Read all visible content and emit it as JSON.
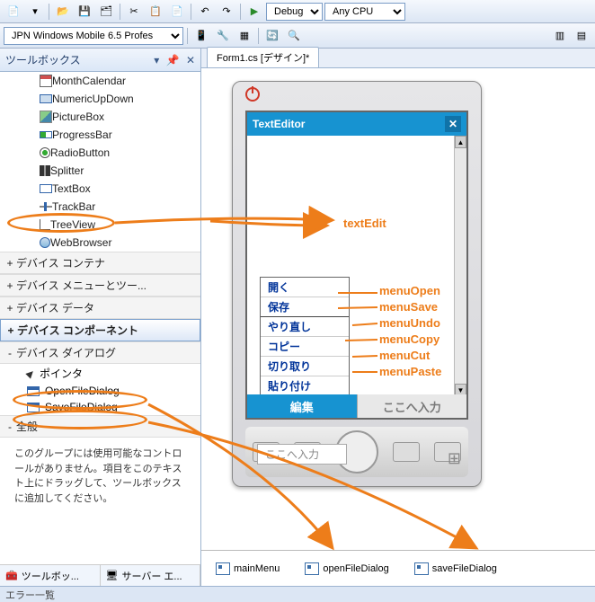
{
  "toolbar1": {
    "debug_config": "Debug",
    "platform": "Any CPU"
  },
  "toolbar2": {
    "device": "JPN Windows Mobile 6.5 Profes"
  },
  "toolbox": {
    "title": "ツールボックス",
    "items": [
      {
        "label": "MonthCalendar",
        "icon": "ico-cal"
      },
      {
        "label": "NumericUpDown",
        "icon": "ico-num"
      },
      {
        "label": "PictureBox",
        "icon": "ico-pic"
      },
      {
        "label": "ProgressBar",
        "icon": "ico-prog"
      },
      {
        "label": "RadioButton",
        "icon": "ico-radio"
      },
      {
        "label": "Splitter",
        "icon": "ico-split"
      },
      {
        "label": "TextBox",
        "icon": "ico-text"
      },
      {
        "label": "TrackBar",
        "icon": "ico-track"
      },
      {
        "label": "TreeView",
        "icon": "ico-tree"
      },
      {
        "label": "WebBrowser",
        "icon": "ico-web"
      }
    ],
    "cats": [
      {
        "label": "デバイス コンテナ",
        "exp": "+"
      },
      {
        "label": "デバイス メニューとツー...",
        "exp": "+"
      },
      {
        "label": "デバイス データ",
        "exp": "+"
      },
      {
        "label": "デバイス コンポーネント",
        "exp": "+",
        "sel": true
      },
      {
        "label": "デバイス ダイアログ",
        "exp": "-"
      }
    ],
    "dialog_items": [
      {
        "label": "ポインタ",
        "icon": "ico-ptr"
      },
      {
        "label": "OpenFileDialog",
        "icon": "ico-dlg"
      },
      {
        "label": "SaveFileDialog",
        "icon": "ico-dlg"
      }
    ],
    "general": {
      "label": "全般",
      "exp": "-"
    },
    "empty": "このグループには使用可能なコントロールがありません。項目をこのテキスト上にドラッグして、ツールボックスに追加してください。",
    "footer": {
      "tab1": "ツールボッ...",
      "tab2": "サーバー エ..."
    }
  },
  "designer": {
    "tab": "Form1.cs [デザイン]*",
    "form_title": "TextEditor",
    "menu": [
      "開く",
      "保存",
      "やり直し",
      "コピー",
      "切り取り",
      "貼り付け"
    ],
    "input_hint": "ここへ入力",
    "soft_left": "編集",
    "soft_right": "ここへ入力"
  },
  "tray": {
    "c1": "mainMenu",
    "c2": "openFileDialog",
    "c3": "saveFileDialog"
  },
  "anno": {
    "textedit": "textEdit",
    "m": [
      "menuOpen",
      "menuSave",
      "menuUndo",
      "menuCopy",
      "menuCut",
      "menuPaste"
    ]
  },
  "status": "エラー一覧"
}
